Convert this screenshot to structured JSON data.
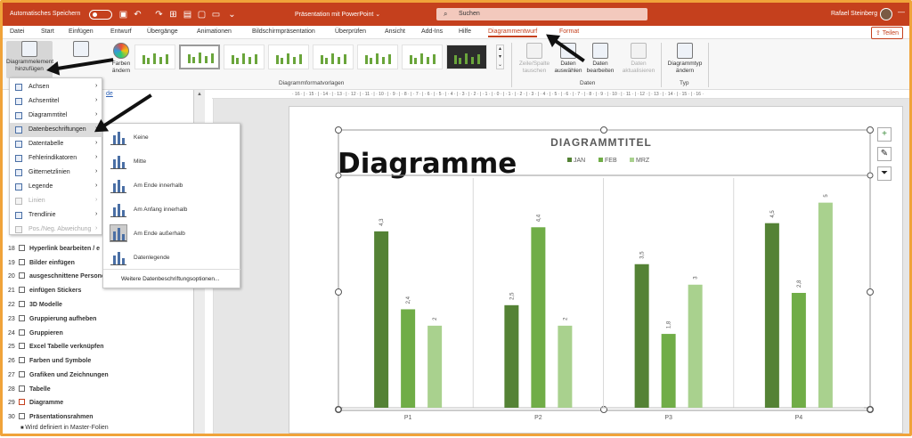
{
  "titlebar": {
    "autosave": "Automatisches Speichern",
    "title": "Präsentation mit PowerPoint ⌄",
    "search": "Suchen",
    "user": "Rafael Steinberg"
  },
  "menu": {
    "items": [
      "Datei",
      "Start",
      "Einfügen",
      "Entwurf",
      "Übergänge",
      "Animationen",
      "Bildschirmpräsentation",
      "Überprüfen",
      "Ansicht",
      "Add-Ins",
      "Hilfe",
      "Diagrammentwurf",
      "Format"
    ],
    "share": "Teilen"
  },
  "ribbon": {
    "add_element": "Diagrammelement hinzufügen",
    "quick_layout": "Schnelllayout",
    "colors": "Farben ändern",
    "styles_group": "Diagrammformatvorlagen",
    "switch": "Zeile/Spalte tauschen",
    "select": "Daten auswählen",
    "edit": "Daten bearbeiten",
    "refresh": "Daten aktualisieren",
    "data_group": "Daten",
    "change_type": "Diagrammtyp ändern",
    "type_group": "Typ"
  },
  "ruler": "· 16 · | · 15 · | · 14 · | · 13 · | · 12 · | · 11 · | · 10 · | · 9 · | · 8 · | · 7 · | · 6 · | · 5 · | · 4 · | · 3 · | · 2 · | · 1 · | · 0 · | · 1 · | · 2 · | · 3 · | · 4 · | · 5 · | · 6 · | · 7 · | · 8 · | · 9 · | · 10 · | · 11 · | · 12 · | · 13 · | · 14 · | · 15 · | · 16 ·",
  "outline": [
    {
      "n": "18",
      "t": "Hyperlink bearbeiten / e"
    },
    {
      "n": "19",
      "t": "Bilder einfügen"
    },
    {
      "n": "20",
      "t": "ausgeschnittene Persone"
    },
    {
      "n": "21",
      "t": "einfügen Stickers"
    },
    {
      "n": "22",
      "t": "3D Modelle"
    },
    {
      "n": "23",
      "t": "Gruppierung aufheben"
    },
    {
      "n": "24",
      "t": "Gruppieren"
    },
    {
      "n": "25",
      "t": "Excel Tabelle verknüpfen"
    },
    {
      "n": "26",
      "t": "Farben und Symbole"
    },
    {
      "n": "27",
      "t": "Grafiken und Zeichnungen"
    },
    {
      "n": "28",
      "t": "Tabelle"
    },
    {
      "n": "29",
      "t": "Diagramme"
    },
    {
      "n": "30",
      "t": "Präsentationsrahmen"
    }
  ],
  "outline_sub": "Wird definiert in Master-Folien",
  "left_link": "de",
  "menu_main": [
    {
      "label": "Achsen",
      "dim": false
    },
    {
      "label": "Achsentitel",
      "dim": false
    },
    {
      "label": "Diagrammtitel",
      "dim": false
    },
    {
      "label": "Datenbeschriftungen",
      "dim": false
    },
    {
      "label": "Datentabelle",
      "dim": false
    },
    {
      "label": "Fehlerindikatoren",
      "dim": false
    },
    {
      "label": "Gitternetzlinien",
      "dim": false
    },
    {
      "label": "Legende",
      "dim": false
    },
    {
      "label": "Linien",
      "dim": true
    },
    {
      "label": "Trendlinie",
      "dim": false
    },
    {
      "label": "Pos./Neg. Abweichung",
      "dim": true
    }
  ],
  "submenu": [
    "Keine",
    "Mitte",
    "Am Ende innerhalb",
    "Am Anfang innerhalb",
    "Am Ende außerhalb",
    "Datenlegende"
  ],
  "submenu_more": "Weitere Datenbeschriftungsoptionen...",
  "slide_heading": "Diagramme",
  "colors": {
    "jan": "#548235",
    "feb": "#70ad47",
    "mrz": "#a9d18e",
    "accent": "#c5401d"
  },
  "chart_data": {
    "type": "bar",
    "title": "DIAGRAMMTITEL",
    "categories": [
      "P1",
      "P2",
      "P3",
      "P4"
    ],
    "series": [
      {
        "name": "JAN",
        "values": [
          4.3,
          2.5,
          3.5,
          4.5
        ]
      },
      {
        "name": "FEB",
        "values": [
          2.4,
          4.4,
          1.8,
          2.8
        ]
      },
      {
        "name": "MRZ",
        "values": [
          2,
          2,
          3,
          5
        ]
      }
    ],
    "data_labels": [
      [
        "4,3",
        "2,5",
        "3,5",
        "4,5"
      ],
      [
        "2,4",
        "4,4",
        "1,8",
        "2,8"
      ],
      [
        "2",
        "2",
        "3",
        "5"
      ]
    ],
    "legend": "top",
    "grid": "vertical category separators"
  }
}
